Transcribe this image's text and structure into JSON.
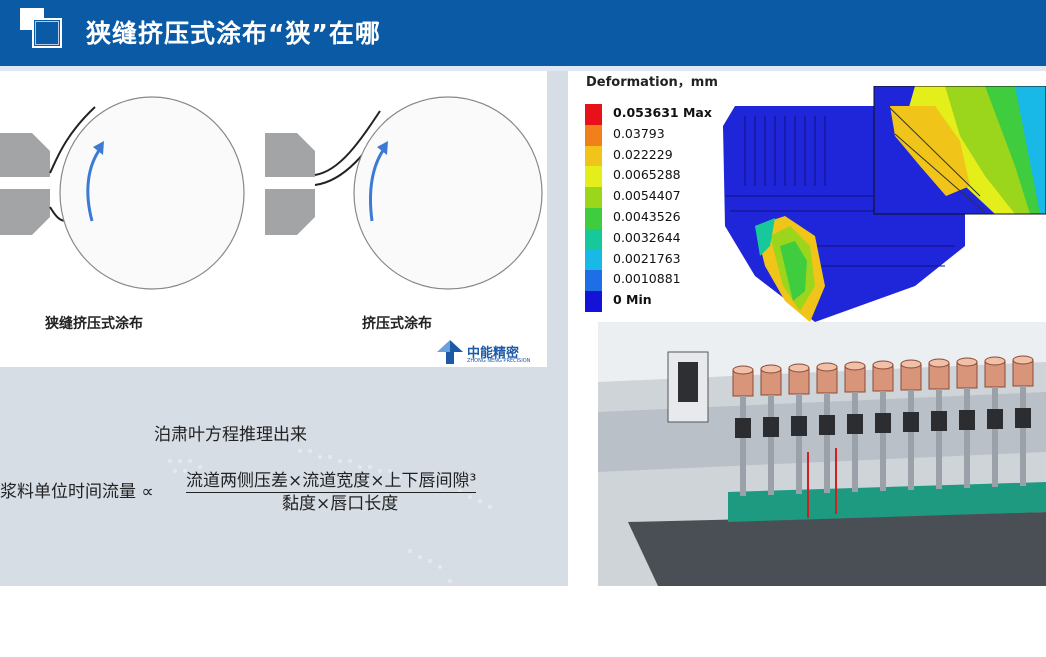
{
  "header": {
    "title": "狭缝挤压式涂布“狭”在哪",
    "bg_color": "#0a5aa6"
  },
  "diagram": {
    "left_label": "狭缝挤压式涂布",
    "right_label": "挤压式涂布",
    "brand": {
      "name": "中能精密",
      "sub": "ZHONG NENG PRECISION",
      "icon": "zhongneng-logo-icon"
    }
  },
  "formula": {
    "heading": "泊肃叶方程推理出来",
    "lhs": "浆料单位时间流量 ∝",
    "numerator": "流道两侧压差×流道宽度×上下唇间隙³",
    "denominator": "黏度×唇口长度"
  },
  "fea": {
    "legend_title": "Deformation，mm",
    "legend": [
      {
        "label": "0.053631 Max",
        "color": "#e8111a",
        "bold": true
      },
      {
        "label": "0.03793",
        "color": "#f2801a",
        "bold": false
      },
      {
        "label": "0.022229",
        "color": "#f0c419",
        "bold": false
      },
      {
        "label": "0.0065288",
        "color": "#e4ee1a",
        "bold": false
      },
      {
        "label": "0.0054407",
        "color": "#9cd61c",
        "bold": false
      },
      {
        "label": "0.0043526",
        "color": "#3fcc3f",
        "bold": false
      },
      {
        "label": "0.0032644",
        "color": "#17c99a",
        "bold": false
      },
      {
        "label": "0.0021763",
        "color": "#18b9e6",
        "bold": false
      },
      {
        "label": "0.0010881",
        "color": "#1e6fe6",
        "bold": false
      },
      {
        "label": "0 Min",
        "color": "#1412d6",
        "bold": true
      }
    ]
  }
}
